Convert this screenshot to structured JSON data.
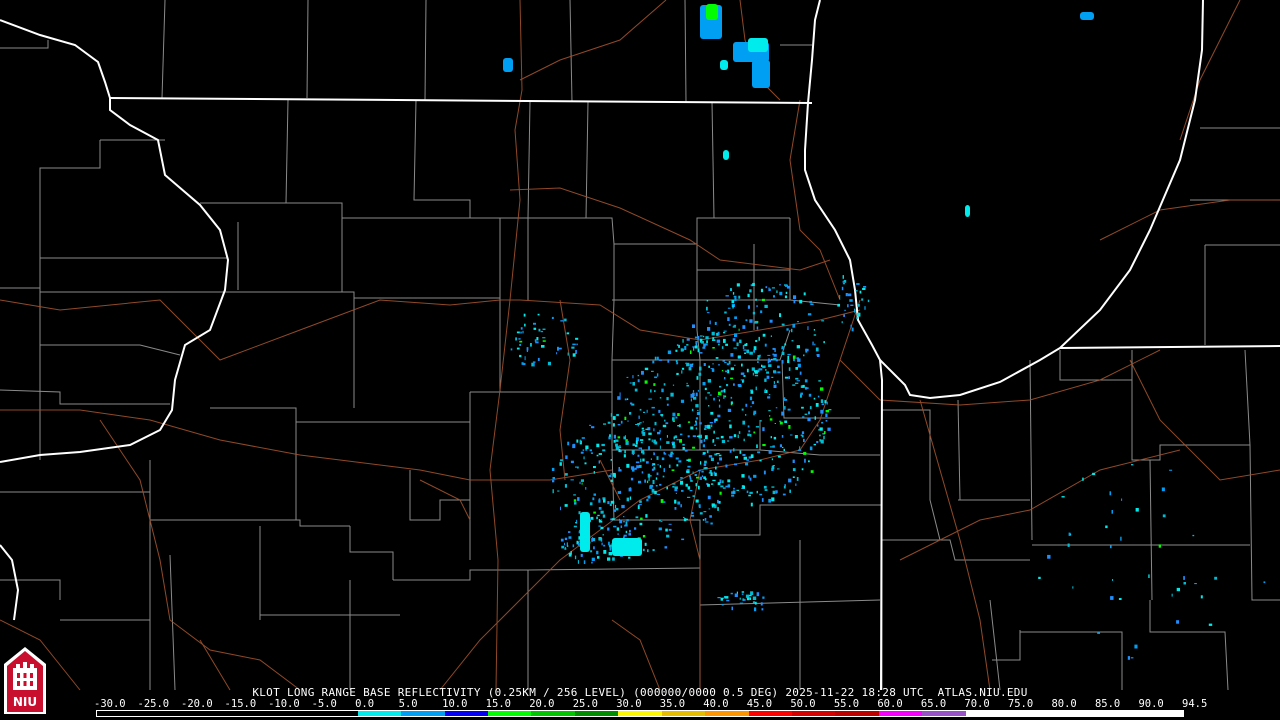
{
  "product": {
    "caption": "KLOT LONG RANGE BASE REFLECTIVITY (0.25KM / 256 LEVEL) (000000/0000 0.5 DEG) 2025-11-22 18:28 UTC  ATLAS.NIU.EDU"
  },
  "scale": {
    "labels": [
      "-30.0",
      "-25.0",
      "-20.0",
      "-15.0",
      "-10.0",
      "-5.0",
      "0.0",
      "5.0",
      "10.0",
      "15.0",
      "20.0",
      "25.0",
      "30.0",
      "35.0",
      "40.0",
      "45.0",
      "50.0",
      "55.0",
      "60.0",
      "65.0",
      "70.0",
      "75.0",
      "80.0",
      "85.0",
      "90.0",
      "94.5"
    ],
    "colors": [
      "#000000",
      "#000000",
      "#000000",
      "#000000",
      "#000000",
      "#000000",
      "#00ecec",
      "#019ff4",
      "#0300f4",
      "#02fd02",
      "#01c501",
      "#008e00",
      "#fdf802",
      "#e5bc00",
      "#fd9500",
      "#fd0000",
      "#d40000",
      "#bc0000",
      "#f800fd",
      "#9854c6",
      "#ffffff",
      "#ffffff",
      "#ffffff",
      "#ffffff",
      "#ffffff"
    ]
  },
  "logo": {
    "text": "NIU"
  }
}
